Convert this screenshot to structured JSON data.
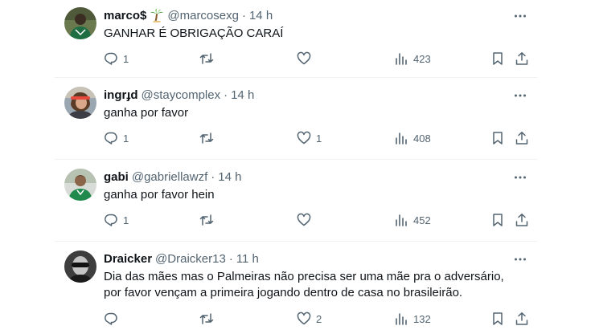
{
  "tweets": [
    {
      "name": "marco$",
      "emoji_icon": "palm-tree-icon",
      "handle": "@marcosexg",
      "separator": "·",
      "time": "14 h",
      "text": "GANHAR É OBRIGAÇÃO CARAÍ",
      "replies": "1",
      "retweets": "",
      "likes": "",
      "views": "423"
    },
    {
      "name": "ingrɟd",
      "handle": "@staycomplex",
      "separator": "·",
      "time": "14 h",
      "text": "ganha por favor",
      "replies": "1",
      "retweets": "",
      "likes": "1",
      "views": "408"
    },
    {
      "name": "gabi",
      "handle": "@gabriellawzf",
      "separator": "·",
      "time": "14 h",
      "text": "ganha por favor hein",
      "replies": "1",
      "retweets": "",
      "likes": "",
      "views": "452"
    },
    {
      "name": "Draicker",
      "handle": "@Draicker13",
      "separator": "·",
      "time": "11 h",
      "text": "Dia das mães mas o Palmeiras não precisa ser uma mãe pra o adversário, por favor vençam a primeira jogando dentro de casa no brasileirão.",
      "replies": "",
      "retweets": "",
      "likes": "2",
      "views": "132"
    }
  ],
  "colors": {
    "text_primary": "#0f1419",
    "text_secondary": "#536471",
    "divider": "#eff3f4",
    "background": "#ffffff"
  }
}
